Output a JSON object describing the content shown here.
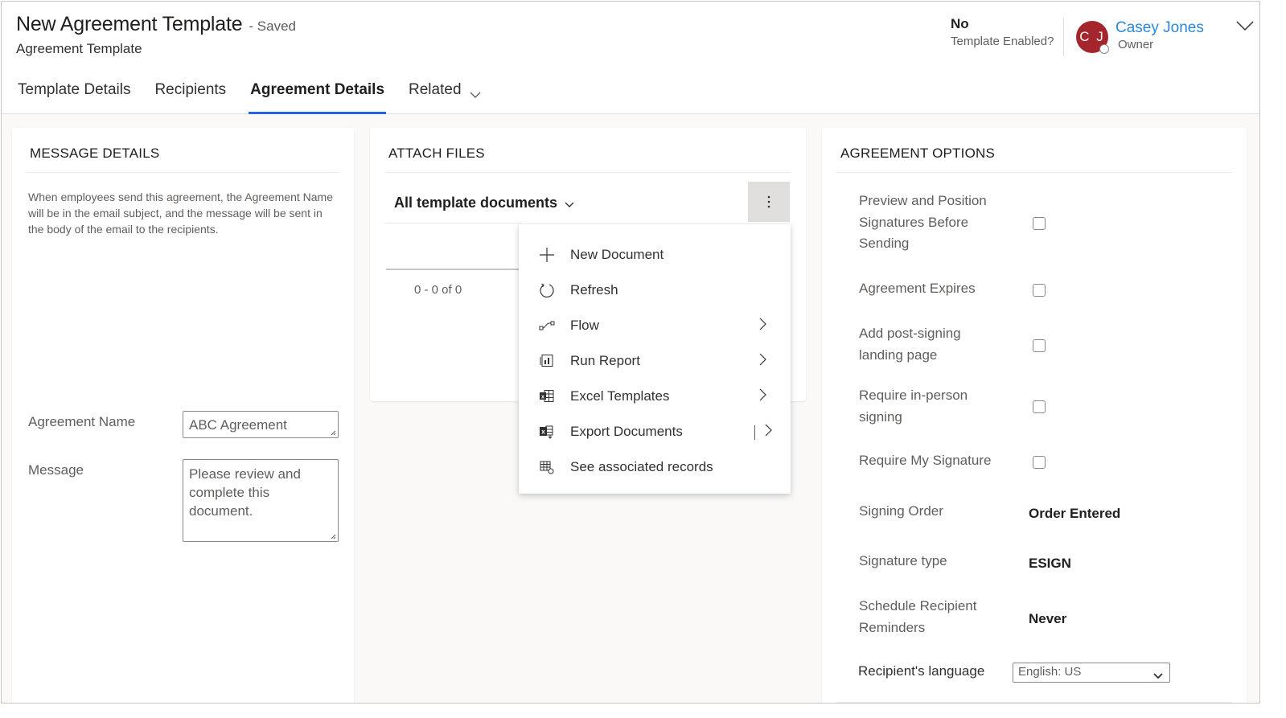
{
  "header": {
    "title": "New Agreement Template",
    "save_status": "- Saved",
    "entity_type": "Agreement Template",
    "template_enabled": {
      "value": "No",
      "label": "Template Enabled?"
    },
    "owner": {
      "initials": "C J",
      "name": "Casey Jones",
      "role": "Owner",
      "avatar_color": "#a4262c"
    }
  },
  "tabs": [
    {
      "label": "Template Details",
      "active": false
    },
    {
      "label": "Recipients",
      "active": false
    },
    {
      "label": "Agreement Details",
      "active": true
    },
    {
      "label": "Related",
      "active": false,
      "has_dropdown": true
    }
  ],
  "message_details": {
    "title": "MESSAGE DETAILS",
    "description": "When employees send this agreement, the Agreement Name will be in the email subject, and the message will be sent in the body of the email to the recipients.",
    "agreement_name": {
      "label": "Agreement Name",
      "value": "ABC Agreement"
    },
    "message": {
      "label": "Message",
      "value": "Please review and complete this document."
    }
  },
  "attach_files": {
    "title": "ATTACH FILES",
    "view_selector": "All template documents",
    "pager": "0 - 0 of 0",
    "more_commands_icon": "kebab-vertical-icon",
    "menu": [
      {
        "label": "New Document",
        "icon": "plus-icon",
        "submenu": false
      },
      {
        "label": "Refresh",
        "icon": "refresh-icon",
        "submenu": false
      },
      {
        "label": "Flow",
        "icon": "flow-icon",
        "submenu": true
      },
      {
        "label": "Run Report",
        "icon": "report-icon",
        "submenu": true
      },
      {
        "label": "Excel Templates",
        "icon": "excel-templates-icon",
        "submenu": true
      },
      {
        "label": "Export Documents",
        "icon": "excel-export-icon",
        "submenu": true,
        "split": true
      },
      {
        "label": "See associated records",
        "icon": "associated-records-icon",
        "submenu": false
      }
    ]
  },
  "agreement_options": {
    "title": "AGREEMENT OPTIONS",
    "checkbox_options": [
      {
        "label": "Preview and Position Signatures Before Sending",
        "checked": false
      },
      {
        "label": "Agreement Expires",
        "checked": false
      },
      {
        "label": "Add post-signing landing page",
        "checked": false
      },
      {
        "label": "Require in-person signing",
        "checked": false
      },
      {
        "label": "Require My Signature",
        "checked": false
      }
    ],
    "value_options": [
      {
        "label": "Signing Order",
        "value": "Order Entered"
      },
      {
        "label": "Signature type",
        "value": "ESIGN"
      },
      {
        "label": "Schedule Recipient Reminders",
        "value": "Never"
      }
    ],
    "language": {
      "label": "Recipient's language",
      "value": "English: US"
    }
  },
  "colors": {
    "accent": "#2266e3",
    "link": "#2b88d8",
    "page_background": "#faf9f8"
  }
}
